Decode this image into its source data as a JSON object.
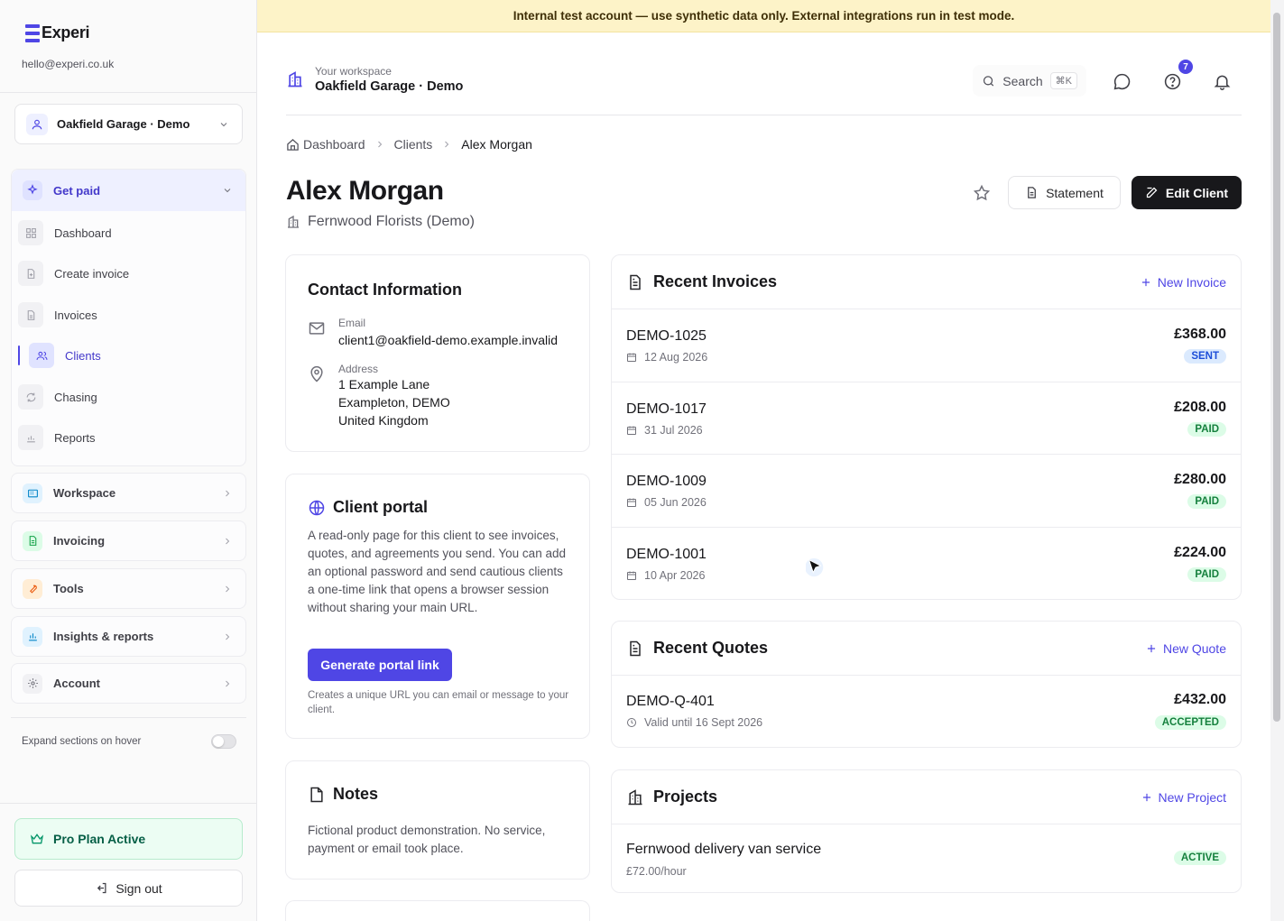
{
  "banner": "Internal test account — use synthetic data only. External integrations run in test mode.",
  "brand": {
    "name": "Experi",
    "email": "hello@experi.co.uk",
    "color": "#4f46e5"
  },
  "sidebar": {
    "workspace_select": "Oakfield Garage · Demo",
    "get_paid": {
      "label": "Get paid",
      "items": [
        {
          "label": "Dashboard",
          "icon": "grid-icon"
        },
        {
          "label": "Create invoice",
          "icon": "file-plus-icon"
        },
        {
          "label": "Invoices",
          "icon": "file-text-icon"
        },
        {
          "label": "Clients",
          "icon": "users-icon",
          "active": true
        },
        {
          "label": "Chasing",
          "icon": "refresh-icon"
        },
        {
          "label": "Reports",
          "icon": "bar-chart-icon"
        }
      ]
    },
    "groups": [
      {
        "label": "Workspace",
        "icon": "building-icon"
      },
      {
        "label": "Invoicing",
        "icon": "document-icon"
      },
      {
        "label": "Tools",
        "icon": "wrench-icon"
      },
      {
        "label": "Insights & reports",
        "icon": "chart-icon"
      },
      {
        "label": "Account",
        "icon": "gear-icon"
      }
    ],
    "expand_toggle": "Expand sections on hover",
    "plan": "Pro Plan Active",
    "sign_out": "Sign out"
  },
  "header": {
    "workspace_small": "Your workspace",
    "workspace_name": "Oakfield Garage · Demo",
    "search_label": "Search",
    "search_shortcut": "⌘K",
    "help_badge": "7"
  },
  "breadcrumb": {
    "items": [
      "Dashboard",
      "Clients"
    ],
    "current": "Alex Morgan"
  },
  "client": {
    "name": "Alex Morgan",
    "company": "Fernwood Florists (Demo)",
    "statement_label": "Statement",
    "edit_label": "Edit Client"
  },
  "contact": {
    "title": "Contact Information",
    "email_label": "Email",
    "email": "client1@oakfield-demo.example.invalid",
    "address_label": "Address",
    "address_lines": [
      "1 Example Lane",
      "Exampleton, DEMO",
      "United Kingdom"
    ]
  },
  "portal": {
    "title": "Client portal",
    "text": "A read-only page for this client to see invoices, quotes, and agreements you send. You can add an optional password and send cautious clients a one-time link that opens a browser session without sharing your main URL.",
    "button": "Generate portal link",
    "note": "Creates a unique URL you can email or message to your client."
  },
  "notes": {
    "title": "Notes",
    "text": "Fictional product demonstration. No service, payment or email took place."
  },
  "invoices": {
    "title": "Recent Invoices",
    "add_label": "New Invoice",
    "rows": [
      {
        "id": "DEMO-1025",
        "date": "12 Aug 2026",
        "amount": "£368.00",
        "status": "SENT"
      },
      {
        "id": "DEMO-1017",
        "date": "31 Jul 2026",
        "amount": "£208.00",
        "status": "PAID"
      },
      {
        "id": "DEMO-1009",
        "date": "05 Jun 2026",
        "amount": "£280.00",
        "status": "PAID"
      },
      {
        "id": "DEMO-1001",
        "date": "10 Apr 2026",
        "amount": "£224.00",
        "status": "PAID"
      }
    ]
  },
  "quotes": {
    "title": "Recent Quotes",
    "add_label": "New Quote",
    "rows": [
      {
        "id": "DEMO-Q-401",
        "valid": "Valid until 16 Sept 2026",
        "amount": "£432.00",
        "status": "ACCEPTED"
      }
    ]
  },
  "projects": {
    "title": "Projects",
    "add_label": "New Project",
    "rows": [
      {
        "name": "Fernwood delivery van service",
        "rate": "£72.00/hour",
        "status": "ACTIVE"
      }
    ]
  }
}
